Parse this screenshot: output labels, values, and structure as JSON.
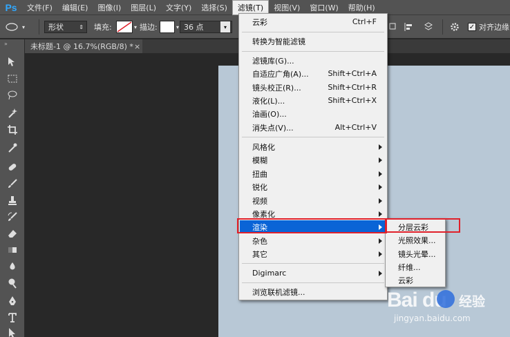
{
  "app": {
    "logo": "Ps"
  },
  "menubar": {
    "items": [
      {
        "label": "文件(F)"
      },
      {
        "label": "编辑(E)"
      },
      {
        "label": "图像(I)"
      },
      {
        "label": "图层(L)"
      },
      {
        "label": "文字(Y)"
      },
      {
        "label": "选择(S)"
      },
      {
        "label": "滤镜(T)",
        "active": true
      },
      {
        "label": "视图(V)"
      },
      {
        "label": "窗口(W)"
      },
      {
        "label": "帮助(H)"
      }
    ]
  },
  "options": {
    "shape_mode": "形状",
    "fill_label": "填充:",
    "stroke_label": "描边:",
    "stroke_size": "36 点",
    "align_edges_label": "对齐边缘"
  },
  "document_tab": {
    "title": "未标题-1 @ 16.7%(RGB/8) *",
    "close": "×"
  },
  "filter_menu": {
    "items": [
      {
        "label": "云彩",
        "shortcut": "Ctrl+F"
      },
      {
        "label": "转换为智能滤镜"
      },
      {
        "label": "滤镜库(G)..."
      },
      {
        "label": "自适应广角(A)...",
        "shortcut": "Shift+Ctrl+A"
      },
      {
        "label": "镜头校正(R)...",
        "shortcut": "Shift+Ctrl+R"
      },
      {
        "label": "液化(L)...",
        "shortcut": "Shift+Ctrl+X"
      },
      {
        "label": "油画(O)..."
      },
      {
        "label": "消失点(V)...",
        "shortcut": "Alt+Ctrl+V"
      },
      {
        "label": "风格化"
      },
      {
        "label": "模糊"
      },
      {
        "label": "扭曲"
      },
      {
        "label": "锐化"
      },
      {
        "label": "视频"
      },
      {
        "label": "像素化"
      },
      {
        "label": "渲染"
      },
      {
        "label": "杂色"
      },
      {
        "label": "其它"
      },
      {
        "label": "Digimarc"
      },
      {
        "label": "浏览联机滤镜..."
      }
    ]
  },
  "render_submenu": {
    "items": [
      {
        "label": "分层云彩"
      },
      {
        "label": "光照效果..."
      },
      {
        "label": "镜头光晕..."
      },
      {
        "label": "纤维..."
      },
      {
        "label": "云彩"
      }
    ]
  },
  "watermark": {
    "brand": "Bai du",
    "jingyan": "经验",
    "url": "jingyan.baidu.com"
  },
  "colors": {
    "accent": "#0a64d6",
    "highlight_box": "#e0202a",
    "canvas": "#b8c8d6"
  }
}
